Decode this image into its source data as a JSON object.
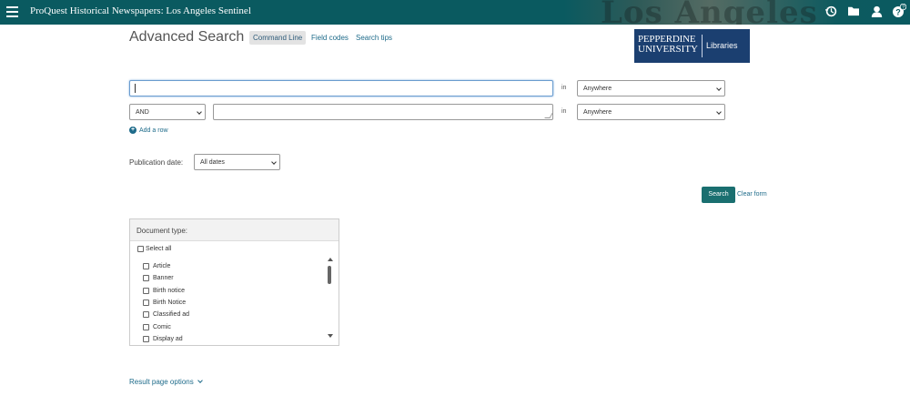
{
  "topbar": {
    "title": "ProQuest Historical Newspapers: Los Angeles Sentinel",
    "watermark": "Los Angeles",
    "icons": [
      "history-icon",
      "folder-icon",
      "user-icon",
      "help-icon"
    ]
  },
  "header": {
    "title": "Advanced Search",
    "links": [
      "Command Line",
      "Field codes",
      "Search tips"
    ]
  },
  "logo": {
    "line1": "PEPPERDINE",
    "line2": "UNIVERSITY",
    "line3": "Libraries"
  },
  "form": {
    "row1": {
      "value": "",
      "in_label": "in",
      "field": "Anywhere"
    },
    "row2": {
      "operator": "AND",
      "value": "",
      "in_label": "in",
      "field": "Anywhere"
    },
    "add_row": "Add a row",
    "publication_date_label": "Publication date:",
    "publication_date_value": "All dates",
    "search_button": "Search",
    "clear_form": "Clear form"
  },
  "document_type": {
    "header": "Document type:",
    "select_all": "Select all",
    "items": [
      "Article",
      "Banner",
      "Birth notice",
      "Birth Notice",
      "Classified ad",
      "Comic",
      "Display ad"
    ]
  },
  "footer": {
    "result_page_options": "Result page options"
  },
  "colors": {
    "topbar": "#0a5a60",
    "accent": "#1a6f70",
    "link": "#1e6b8a",
    "logo_bg": "#1b3f70"
  }
}
